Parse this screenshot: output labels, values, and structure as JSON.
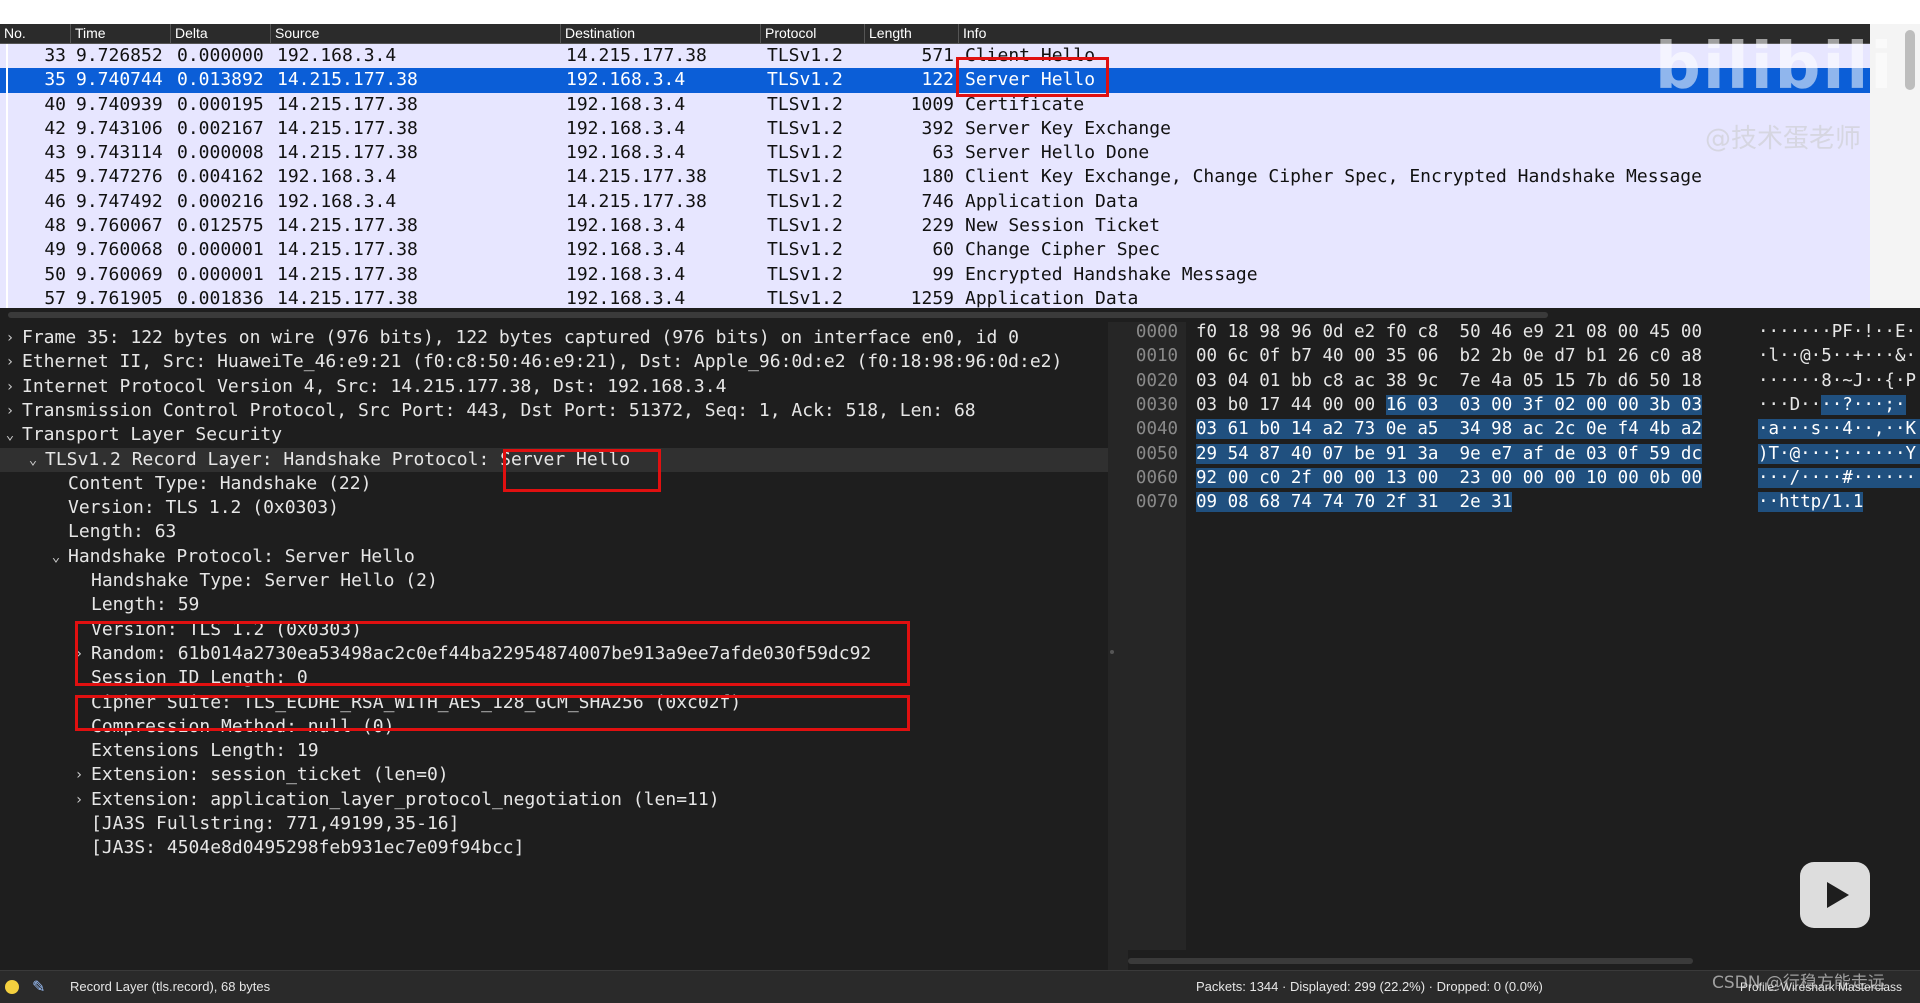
{
  "packet_list": {
    "columns": [
      "No.",
      "Time",
      "Delta",
      "Source",
      "Destination",
      "Protocol",
      "Length",
      "Info"
    ],
    "rows": [
      {
        "no": "33",
        "time": "9.726852",
        "delta": "0.000000",
        "src": "192.168.3.4",
        "dst": "14.215.177.38",
        "proto": "TLSv1.2",
        "len": "571",
        "info": "Client Hello"
      },
      {
        "no": "35",
        "time": "9.740744",
        "delta": "0.013892",
        "src": "14.215.177.38",
        "dst": "192.168.3.4",
        "proto": "TLSv1.2",
        "len": "122",
        "info": "Server Hello"
      },
      {
        "no": "40",
        "time": "9.740939",
        "delta": "0.000195",
        "src": "14.215.177.38",
        "dst": "192.168.3.4",
        "proto": "TLSv1.2",
        "len": "1009",
        "info": "Certificate"
      },
      {
        "no": "42",
        "time": "9.743106",
        "delta": "0.002167",
        "src": "14.215.177.38",
        "dst": "192.168.3.4",
        "proto": "TLSv1.2",
        "len": "392",
        "info": "Server Key Exchange"
      },
      {
        "no": "43",
        "time": "9.743114",
        "delta": "0.000008",
        "src": "14.215.177.38",
        "dst": "192.168.3.4",
        "proto": "TLSv1.2",
        "len": "63",
        "info": "Server Hello Done"
      },
      {
        "no": "45",
        "time": "9.747276",
        "delta": "0.004162",
        "src": "192.168.3.4",
        "dst": "14.215.177.38",
        "proto": "TLSv1.2",
        "len": "180",
        "info": "Client Key Exchange, Change Cipher Spec, Encrypted Handshake Message"
      },
      {
        "no": "46",
        "time": "9.747492",
        "delta": "0.000216",
        "src": "192.168.3.4",
        "dst": "14.215.177.38",
        "proto": "TLSv1.2",
        "len": "746",
        "info": "Application Data"
      },
      {
        "no": "48",
        "time": "9.760067",
        "delta": "0.012575",
        "src": "14.215.177.38",
        "dst": "192.168.3.4",
        "proto": "TLSv1.2",
        "len": "229",
        "info": "New Session Ticket"
      },
      {
        "no": "49",
        "time": "9.760068",
        "delta": "0.000001",
        "src": "14.215.177.38",
        "dst": "192.168.3.4",
        "proto": "TLSv1.2",
        "len": "60",
        "info": "Change Cipher Spec"
      },
      {
        "no": "50",
        "time": "9.760069",
        "delta": "0.000001",
        "src": "14.215.177.38",
        "dst": "192.168.3.4",
        "proto": "TLSv1.2",
        "len": "99",
        "info": "Encrypted Handshake Message"
      },
      {
        "no": "57",
        "time": "9.761905",
        "delta": "0.001836",
        "src": "14.215.177.38",
        "dst": "192.168.3.4",
        "proto": "TLSv1.2",
        "len": "1259",
        "info": "Application Data"
      }
    ],
    "selected_no": "35"
  },
  "details": {
    "lines": [
      {
        "arrow": "right",
        "text": "Frame 35: 122 bytes on wire (976 bits), 122 bytes captured (976 bits) on interface en0, id 0"
      },
      {
        "arrow": "right",
        "text": "Ethernet II, Src: HuaweiTe_46:e9:21 (f0:c8:50:46:e9:21), Dst: Apple_96:0d:e2 (f0:18:98:96:0d:e2)"
      },
      {
        "arrow": "right",
        "text": "Internet Protocol Version 4, Src: 14.215.177.38, Dst: 192.168.3.4"
      },
      {
        "arrow": "right",
        "text": "Transmission Control Protocol, Src Port: 443, Dst Port: 51372, Seq: 1, Ack: 518, Len: 68"
      },
      {
        "arrow": "down",
        "text": "Transport Layer Security"
      },
      {
        "arrow": "down",
        "text": "TLSv1.2 Record Layer: Handshake Protocol: Server Hello"
      },
      {
        "arrow": "",
        "text": "Content Type: Handshake (22)"
      },
      {
        "arrow": "",
        "text": "Version: TLS 1.2 (0x0303)"
      },
      {
        "arrow": "",
        "text": "Length: 63"
      },
      {
        "arrow": "down",
        "text": "Handshake Protocol: Server Hello"
      },
      {
        "arrow": "",
        "text": "Handshake Type: Server Hello (2)"
      },
      {
        "arrow": "",
        "text": "Length: 59"
      },
      {
        "arrow": "",
        "text": "Version: TLS 1.2 (0x0303)"
      },
      {
        "arrow": "right",
        "text": "Random: 61b014a2730ea53498ac2c0ef44ba22954874007be913a9ee7afde030f59dc92"
      },
      {
        "arrow": "",
        "text": "Session ID Length: 0"
      },
      {
        "arrow": "",
        "text": "Cipher Suite: TLS_ECDHE_RSA_WITH_AES_128_GCM_SHA256 (0xc02f)"
      },
      {
        "arrow": "",
        "text": "Compression Method: null (0)"
      },
      {
        "arrow": "",
        "text": "Extensions Length: 19"
      },
      {
        "arrow": "right",
        "text": "Extension: session_ticket (len=0)"
      },
      {
        "arrow": "right",
        "text": "Extension: application_layer_protocol_negotiation (len=11)"
      },
      {
        "arrow": "",
        "text": "[JA3S Fullstring: 771,49199,35-16]"
      },
      {
        "arrow": "",
        "text": "[JA3S: 4504e8d0495298feb931ec7e09f94bcc]"
      }
    ]
  },
  "bytes": {
    "rows": [
      {
        "off": "0000",
        "hex": [
          "f0",
          "18",
          "98",
          "96",
          "0d",
          "e2",
          "f0",
          "c8",
          "50",
          "46",
          "e9",
          "21",
          "08",
          "00",
          "45",
          "00"
        ],
        "ascii": "·······PF·!··E·",
        "sel_from": 16
      },
      {
        "off": "0010",
        "hex": [
          "00",
          "6c",
          "0f",
          "b7",
          "40",
          "00",
          "35",
          "06",
          "b2",
          "2b",
          "0e",
          "d7",
          "b1",
          "26",
          "c0",
          "a8"
        ],
        "ascii": "·l··@·5··+···&··",
        "sel_from": 16
      },
      {
        "off": "0020",
        "hex": [
          "03",
          "04",
          "01",
          "bb",
          "c8",
          "ac",
          "38",
          "9c",
          "7e",
          "4a",
          "05",
          "15",
          "7b",
          "d6",
          "50",
          "18"
        ],
        "ascii": "······8·~J··{·P·",
        "sel_from": 16
      },
      {
        "off": "0030",
        "hex": [
          "03",
          "b0",
          "17",
          "44",
          "00",
          "00",
          "16",
          "03",
          "03",
          "00",
          "3f",
          "02",
          "00",
          "00",
          "3b",
          "03"
        ],
        "ascii": "···D····?···;·",
        "sel_from": 6
      },
      {
        "off": "0040",
        "hex": [
          "03",
          "61",
          "b0",
          "14",
          "a2",
          "73",
          "0e",
          "a5",
          "34",
          "98",
          "ac",
          "2c",
          "0e",
          "f4",
          "4b",
          "a2"
        ],
        "ascii": "·a···s··4··,··K·",
        "sel_from": 0
      },
      {
        "off": "0050",
        "hex": [
          "29",
          "54",
          "87",
          "40",
          "07",
          "be",
          "91",
          "3a",
          "9e",
          "e7",
          "af",
          "de",
          "03",
          "0f",
          "59",
          "dc"
        ],
        "ascii": ")T·@···:······Y·",
        "sel_from": 0
      },
      {
        "off": "0060",
        "hex": [
          "92",
          "00",
          "c0",
          "2f",
          "00",
          "00",
          "13",
          "00",
          "23",
          "00",
          "00",
          "00",
          "10",
          "00",
          "0b",
          "00"
        ],
        "ascii": "···/····#·······",
        "sel_from": 0
      },
      {
        "off": "0070",
        "hex": [
          "09",
          "08",
          "68",
          "74",
          "74",
          "70",
          "2f",
          "31",
          "2e",
          "31"
        ],
        "ascii": "··http/1.1",
        "sel_from": 0
      }
    ]
  },
  "status": {
    "field": "Record Layer (tls.record), 68 bytes",
    "packets": "Packets: 1344 · Displayed: 299 (22.2%) · Dropped: 0 (0.0%)",
    "profile": "Profile: Wireshark Masterclass"
  },
  "watermarks": {
    "logo": "bilibili",
    "author": "@技术蛋老师",
    "csdn": "CSDN @行稳方能走远"
  },
  "colors": {
    "selection": "#0b5ed7",
    "tls_row": "#e7e6ff",
    "highlight_box": "#e01010",
    "byte_selection": "#20507f"
  }
}
